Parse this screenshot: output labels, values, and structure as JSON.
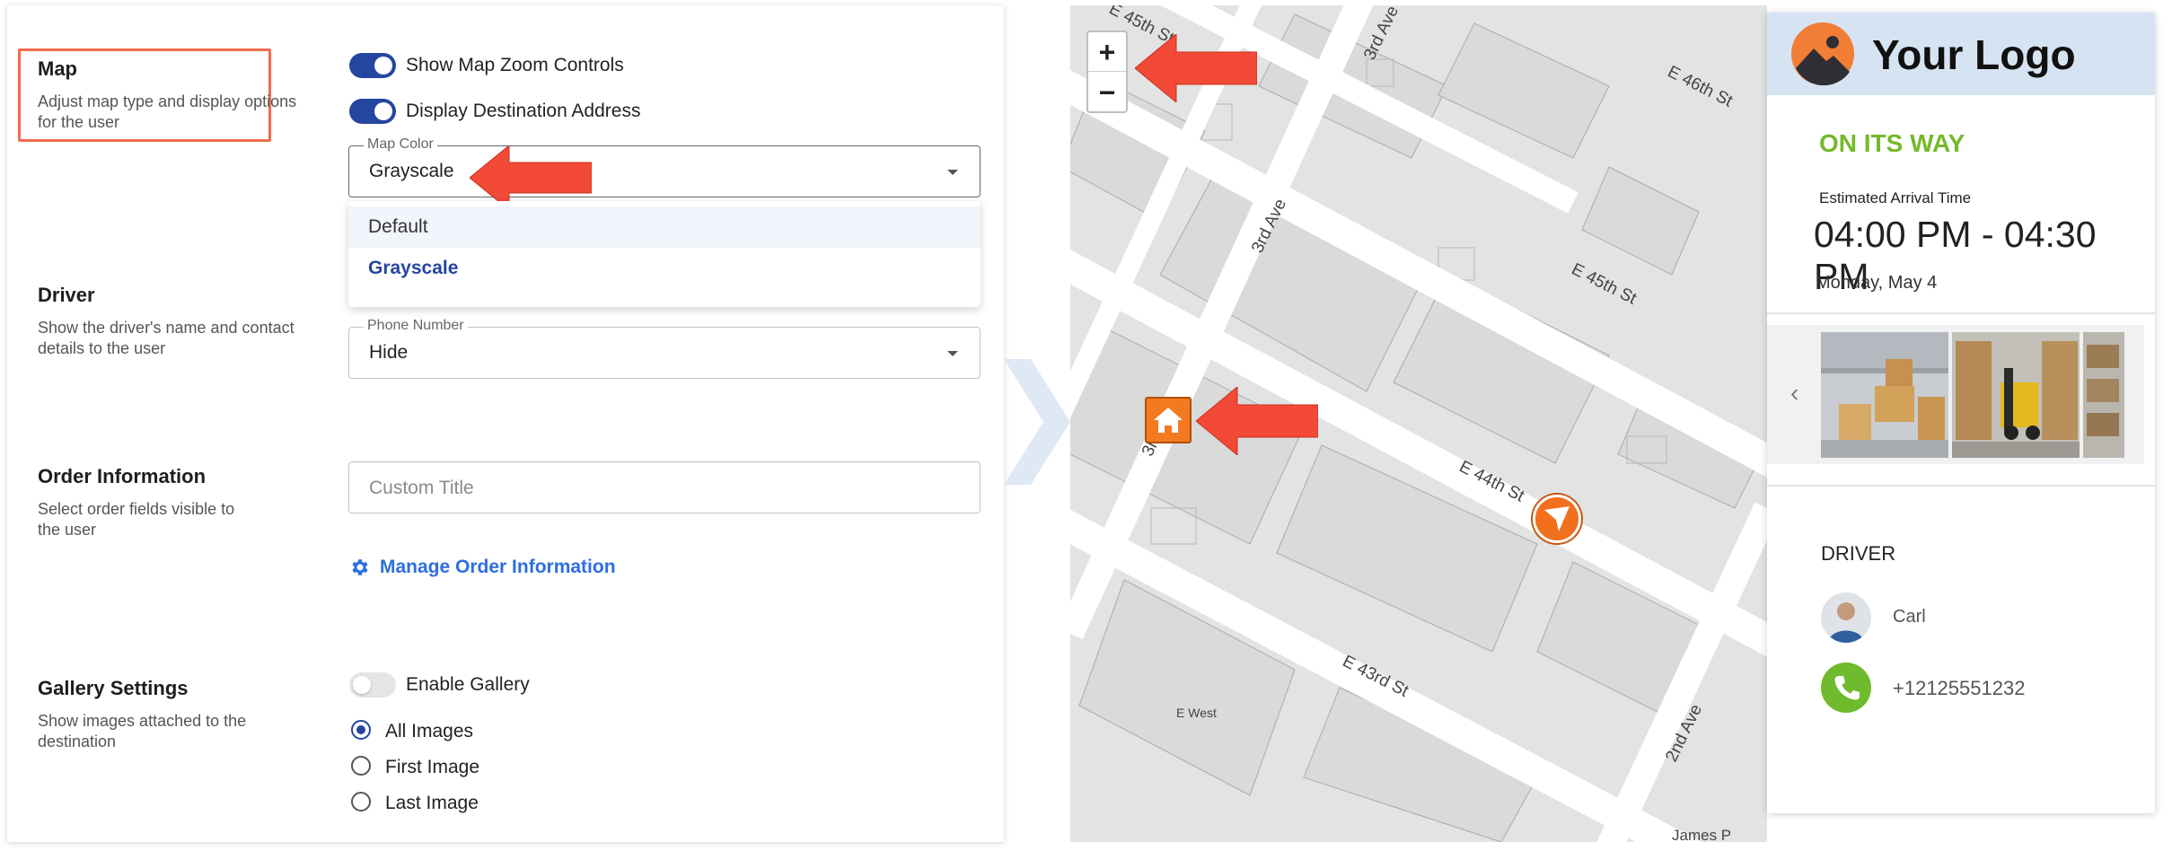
{
  "settings": {
    "map": {
      "title": "Map",
      "description": "Adjust map type and display options for the user",
      "zoom_toggle": {
        "label": "Show Map Zoom Controls",
        "checked": true
      },
      "address_toggle": {
        "label": "Display Destination Address",
        "checked": true
      },
      "map_color": {
        "legend": "Map Color",
        "value": "Grayscale",
        "options": [
          "Default",
          "Grayscale"
        ]
      }
    },
    "driver": {
      "title": "Driver",
      "description": "Show the driver's name and contact details to the user",
      "phone_number": {
        "legend": "Phone Number",
        "value": "Hide"
      }
    },
    "order": {
      "title": "Order Information",
      "description": "Select order fields visible to the user",
      "custom_title_placeholder": "Custom Title",
      "manage_link": "Manage Order Information"
    },
    "gallery": {
      "title": "Gallery Settings",
      "description": "Show images attached to the destination",
      "enable_toggle": {
        "label": "Enable Gallery",
        "checked": false
      },
      "radio_options": [
        "All Images",
        "First Image",
        "Last Image"
      ],
      "selected": "All Images"
    }
  },
  "map": {
    "streets": [
      "E 45th St",
      "3rd Ave",
      "E 46th St",
      "3rd Ave",
      "E 45th St",
      "3rd",
      "E 44th St",
      "E 43rd St",
      "E West",
      "2nd Ave",
      "James P"
    ],
    "zoom_in": "+",
    "zoom_out": "−"
  },
  "card": {
    "logo": "Your Logo",
    "status": "ON ITS WAY",
    "eta_label": "Estimated Arrival Time",
    "eta_time": "04:00 PM - 04:30 PM",
    "eta_date": "Monday, May 4",
    "driver_heading": "DRIVER",
    "driver_name": "Carl",
    "driver_phone": "+12125551232"
  },
  "colors": {
    "accent": "#2546a0",
    "link": "#2d6ee0",
    "highlight": "#f26b4f",
    "status_green": "#76b82a",
    "marker_orange": "#f47a20"
  }
}
